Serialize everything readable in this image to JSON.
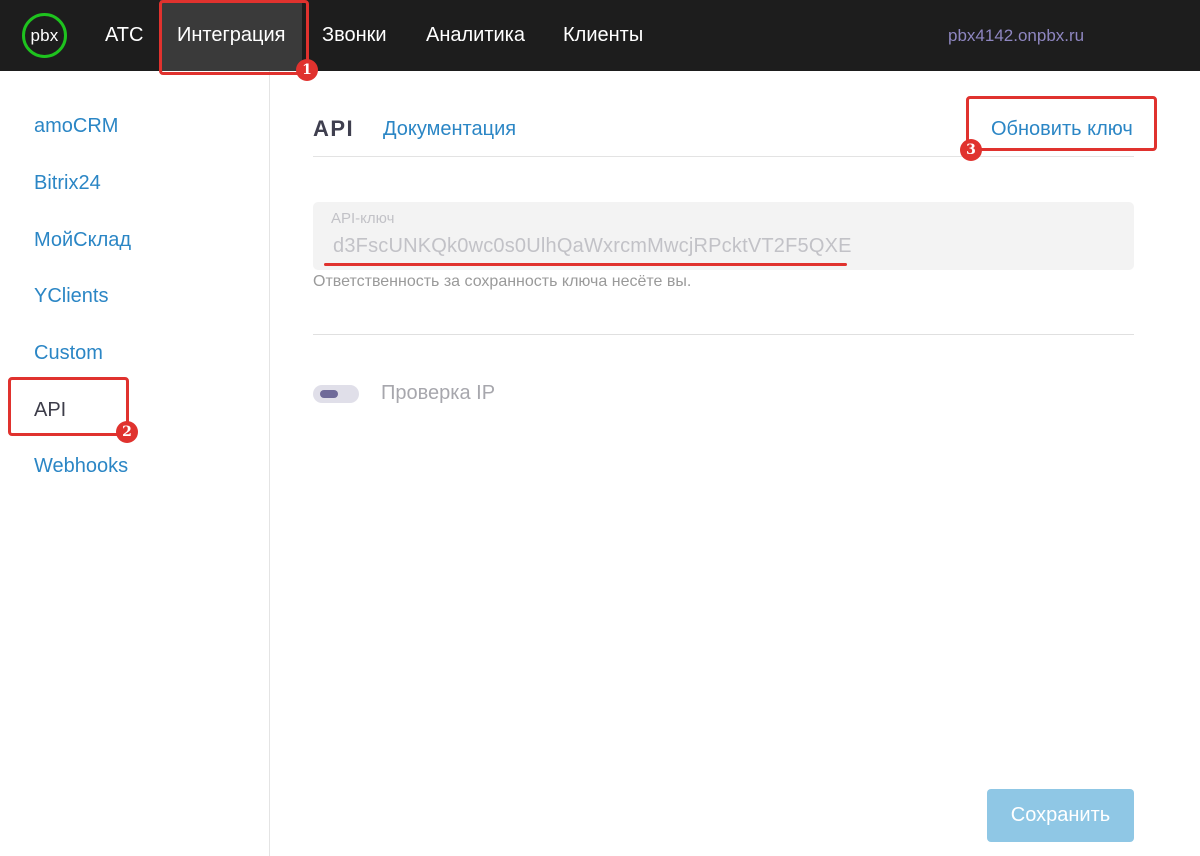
{
  "header": {
    "logo_text": "pbx",
    "nav": [
      {
        "label": "АТС"
      },
      {
        "label": "Интеграция",
        "active": true
      },
      {
        "label": "Звонки"
      },
      {
        "label": "Аналитика"
      },
      {
        "label": "Клиенты"
      }
    ],
    "host": "pbx4142.onpbx.ru"
  },
  "sidebar": {
    "items": [
      {
        "label": "amoCRM"
      },
      {
        "label": "Bitrix24"
      },
      {
        "label": "МойСклад"
      },
      {
        "label": "YClients"
      },
      {
        "label": "Custom"
      },
      {
        "label": "API",
        "active": true
      },
      {
        "label": "Webhooks"
      }
    ]
  },
  "main": {
    "tab_api": "API",
    "tab_docs": "Документация",
    "refresh_key": "Обновить ключ",
    "api_key_label": "API-ключ",
    "api_key_value": "d3FscUNKQk0wc0s0UlhQaWxrcmMwcjRPcktVT2F5QXE",
    "hint": "Ответственность за сохранность ключа несёте вы.",
    "ip_check_label": "Проверка IP",
    "ip_check_enabled": false,
    "save_label": "Сохранить"
  },
  "annotations": {
    "badges": [
      "1",
      "2",
      "3"
    ],
    "color": "#e0322e"
  },
  "colors": {
    "topbar": "#1d1d1d",
    "link": "#2b86c5",
    "logo_ring": "#1ec31e",
    "save_button": "#8fc7e5"
  }
}
